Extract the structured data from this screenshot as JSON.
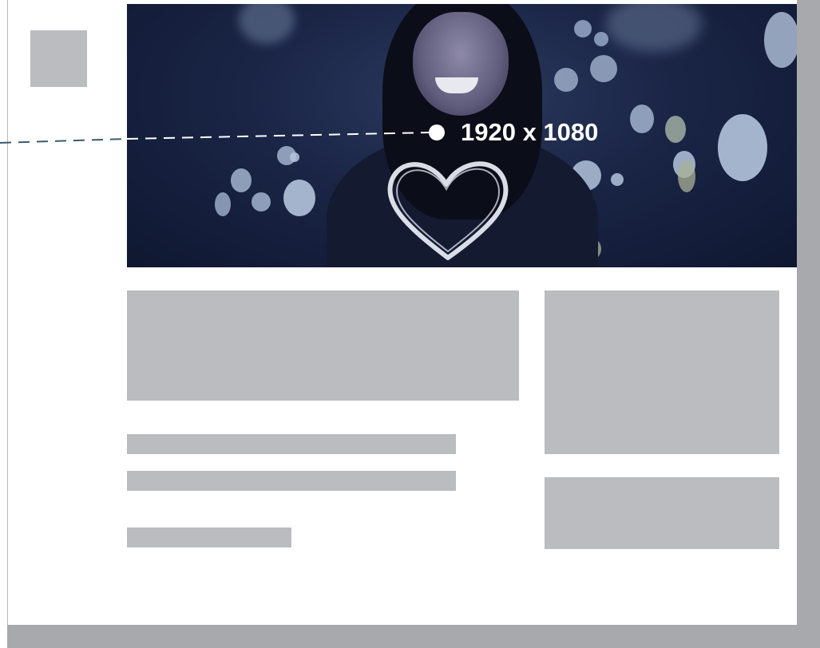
{
  "hero": {
    "dimension_label": "1920 x 1080"
  },
  "colors": {
    "placeholder": "#bbbcc0",
    "frame": "#a8a9ad",
    "hero_overlay": "#1a2546",
    "dimension_line": "#3b5a70",
    "label": "#ffffff"
  }
}
